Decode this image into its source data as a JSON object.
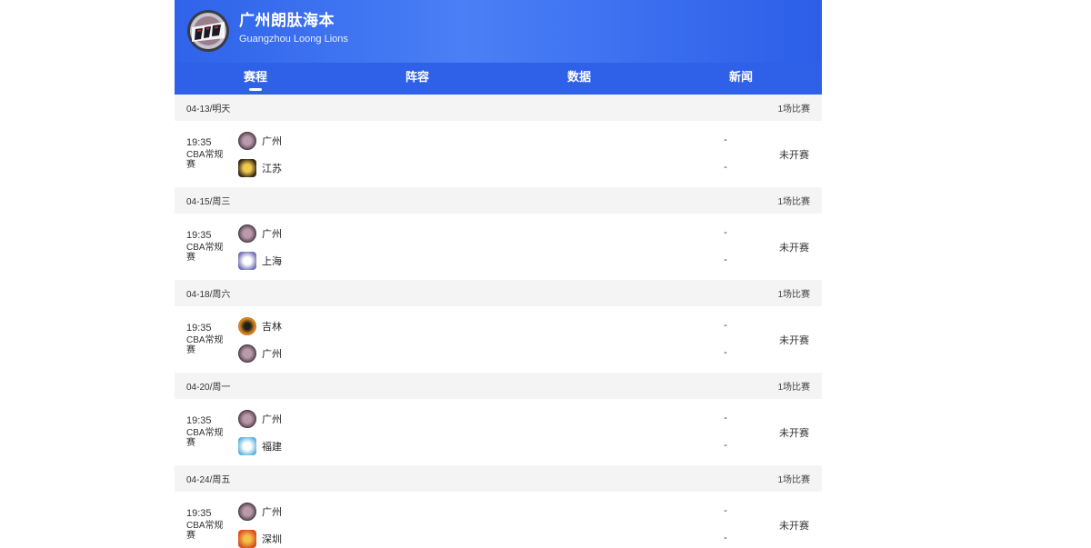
{
  "header": {
    "team_name": "广州朗肽海本",
    "team_name_en": "Guangzhou Loong Lions",
    "logo_icon": "loong-lions-logo-icon"
  },
  "nav": {
    "tabs": [
      {
        "label": "赛程",
        "active": true
      },
      {
        "label": "阵容",
        "active": false
      },
      {
        "label": "数据",
        "active": false
      },
      {
        "label": "新闻",
        "active": false
      }
    ]
  },
  "days": [
    {
      "date": "04-13/明天",
      "count": "1场比赛",
      "game": {
        "time": "19:35",
        "league": "CBA常规赛",
        "home": {
          "name": "广州",
          "icon": "guangzhou-logo-icon",
          "score": "-"
        },
        "away": {
          "name": "江苏",
          "icon": "jiangsu-logo-icon",
          "score": "-"
        },
        "status": "未开赛"
      }
    },
    {
      "date": "04-15/周三",
      "count": "1场比赛",
      "game": {
        "time": "19:35",
        "league": "CBA常规赛",
        "home": {
          "name": "广州",
          "icon": "guangzhou-logo-icon",
          "score": "-"
        },
        "away": {
          "name": "上海",
          "icon": "shanghai-logo-icon",
          "score": "-"
        },
        "status": "未开赛"
      }
    },
    {
      "date": "04-18/周六",
      "count": "1场比赛",
      "game": {
        "time": "19:35",
        "league": "CBA常规赛",
        "home": {
          "name": "吉林",
          "icon": "jilin-logo-icon",
          "score": "-"
        },
        "away": {
          "name": "广州",
          "icon": "guangzhou-logo-icon",
          "score": "-"
        },
        "status": "未开赛"
      }
    },
    {
      "date": "04-20/周一",
      "count": "1场比赛",
      "game": {
        "time": "19:35",
        "league": "CBA常规赛",
        "home": {
          "name": "广州",
          "icon": "guangzhou-logo-icon",
          "score": "-"
        },
        "away": {
          "name": "福建",
          "icon": "fujian-logo-icon",
          "score": "-"
        },
        "status": "未开赛"
      }
    },
    {
      "date": "04-24/周五",
      "count": "1场比赛",
      "game": {
        "time": "19:35",
        "league": "CBA常规赛",
        "home": {
          "name": "广州",
          "icon": "guangzhou-logo-icon",
          "score": "-"
        },
        "away": {
          "name": "深圳",
          "icon": "shenzhen-logo-icon",
          "score": "-"
        },
        "status": "未开赛"
      }
    }
  ],
  "colors": {
    "header_blue": "#2f63ea",
    "nav_blue": "#2f60e8",
    "day_header_bg": "#f4f4f4",
    "guangzhou_badge": "#8a6f7e",
    "jiangsu_badge": "#d8a531",
    "shanghai_badge": "#6b6ab4",
    "jilin_badge": "#e08a1c",
    "fujian_badge": "#4aa9d9",
    "shenzhen_badge": "#d8511d"
  }
}
